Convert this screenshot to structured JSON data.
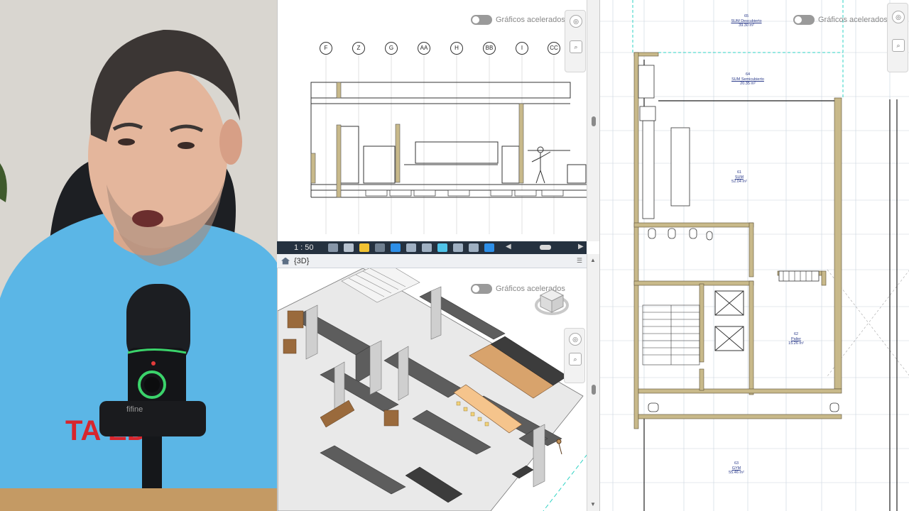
{
  "section_view": {
    "graphics_toggle_label": "Gráficos acelerados",
    "grid_bubbles": [
      "F",
      "Z",
      "G",
      "AA",
      "H",
      "BB",
      "I",
      "CC"
    ],
    "scale_label": "1 : 50"
  },
  "view3d": {
    "tab_label": "{3D}",
    "graphics_toggle_label": "Gráficos acelerados"
  },
  "floor_plan": {
    "graphics_toggle_label": "Gráficos acelerados",
    "rooms": [
      {
        "number": "65",
        "name": "SUM Descubierto",
        "area": "39.30 m²"
      },
      {
        "number": "64",
        "name": "SUM Semicubierto",
        "area": "20.35 m²"
      },
      {
        "number": "61",
        "name": "SUM",
        "area": "52.04 m²"
      },
      {
        "number": "62",
        "name": "Palier",
        "area": "15.26 m²"
      },
      {
        "number": "63",
        "name": "GYM",
        "area": "55.46 m²"
      }
    ]
  },
  "webcam": {
    "shirt_text": "TA    ED",
    "mic_brand": "fifine"
  },
  "colors": {
    "wall_fill": "#c8b98a",
    "view_control_bar": "#25313f",
    "grid_line": "#c9d2de",
    "accent_dashed": "#2fd3c4",
    "counter_fill": "#f5c48c"
  }
}
